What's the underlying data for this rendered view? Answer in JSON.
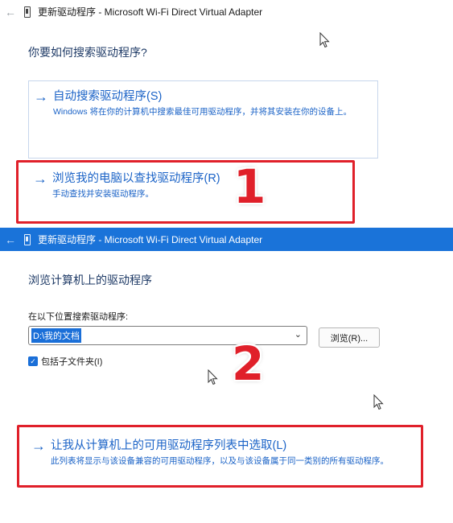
{
  "panel1": {
    "titlebar": {
      "back_icon": "←",
      "title": "更新驱动程序 - Microsoft Wi-Fi Direct Virtual Adapter"
    },
    "heading": "你要如何搜索驱动程序?",
    "choice_auto": {
      "title": "自动搜索驱动程序(S)",
      "description": "Windows 将在你的计算机中搜索最佳可用驱动程序，并将其安装在你的设备上。"
    },
    "choice_browse": {
      "title": "浏览我的电脑以查找驱动程序(R)",
      "description": "手动查找并安装驱动程序。"
    },
    "badge": "1"
  },
  "panel2": {
    "titlebar": {
      "back_icon": "←",
      "title": "更新驱动程序 - Microsoft Wi-Fi Direct Virtual Adapter"
    },
    "heading": "浏览计算机上的驱动程序",
    "search_label": "在以下位置搜索驱动程序:",
    "path_value": "D:\\我的文档",
    "browse_button": "浏览(R)...",
    "include_subfolders": "包括子文件夹(I)",
    "choice_list": {
      "title": "让我从计算机上的可用驱动程序列表中选取(L)",
      "description": "此列表将显示与该设备兼容的可用驱动程序，以及与该设备属于同一类别的所有驱动程序。"
    },
    "badge": "2"
  },
  "colors": {
    "accent_blue": "#1b63c7",
    "titlebar_active": "#1a73d9",
    "highlight_red": "#e0202a"
  },
  "icons": {
    "arrow": "→",
    "chevron": "⌄",
    "check": "✓"
  }
}
